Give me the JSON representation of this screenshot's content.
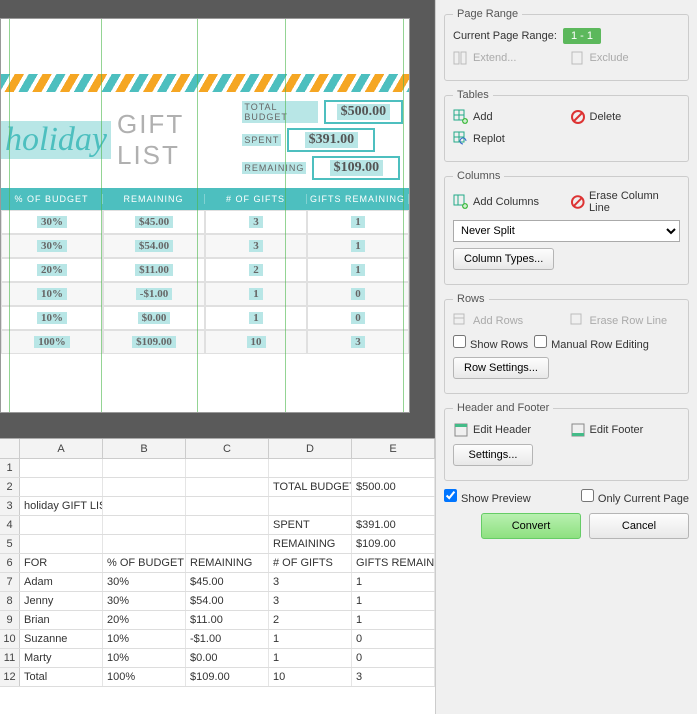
{
  "preview": {
    "title_script": "holiday",
    "title_caps": "GIFT LIST",
    "budget_labels": {
      "total": "TOTAL BUDGET",
      "spent": "SPENT",
      "remaining": "REMAINING"
    },
    "budget_values": {
      "total": "$500.00",
      "spent": "$391.00",
      "remaining": "$109.00"
    },
    "columns": [
      "% OF BUDGET",
      "REMAINING",
      "# OF GIFTS",
      "GIFTS REMAINING"
    ],
    "rows": [
      [
        "30%",
        "$45.00",
        "3",
        "1"
      ],
      [
        "30%",
        "$54.00",
        "3",
        "1"
      ],
      [
        "20%",
        "$11.00",
        "2",
        "1"
      ],
      [
        "10%",
        "-$1.00",
        "1",
        "0"
      ],
      [
        "10%",
        "$0.00",
        "1",
        "0"
      ],
      [
        "100%",
        "$109.00",
        "10",
        "3"
      ]
    ]
  },
  "spreadsheet": {
    "columns": [
      "A",
      "B",
      "C",
      "D",
      "E"
    ],
    "rows": [
      [
        "",
        "",
        "",
        "",
        ""
      ],
      [
        "",
        "",
        "",
        "TOTAL BUDGET",
        "$500.00"
      ],
      [
        "holiday  GIFT LIST",
        "",
        "",
        "",
        ""
      ],
      [
        "",
        "",
        "",
        "SPENT",
        "$391.00"
      ],
      [
        "",
        "",
        "",
        "REMAINING",
        "$109.00"
      ],
      [
        "FOR",
        "% OF BUDGET",
        "REMAINING",
        "# OF GIFTS",
        "GIFTS REMAINING"
      ],
      [
        "Adam",
        "30%",
        "$45.00",
        "3",
        "1"
      ],
      [
        "Jenny",
        "30%",
        "$54.00",
        "3",
        "1"
      ],
      [
        "Brian",
        "20%",
        "$11.00",
        "2",
        "1"
      ],
      [
        "Suzanne",
        "10%",
        "-$1.00",
        "1",
        "0"
      ],
      [
        "Marty",
        "10%",
        "$0.00",
        "1",
        "0"
      ],
      [
        "Total",
        "100%",
        "$109.00",
        "10",
        "3"
      ]
    ]
  },
  "panel": {
    "page_range": {
      "legend": "Page Range",
      "current_label": "Current Page Range:",
      "current_value": "1 - 1",
      "extend": "Extend...",
      "exclude": "Exclude"
    },
    "tables": {
      "legend": "Tables",
      "add": "Add",
      "delete": "Delete",
      "replot": "Replot"
    },
    "columns": {
      "legend": "Columns",
      "add": "Add Columns",
      "erase": "Erase Column Line",
      "split": "Never Split",
      "types": "Column Types..."
    },
    "rows": {
      "legend": "Rows",
      "add": "Add Rows",
      "erase": "Erase Row Line",
      "show": "Show Rows",
      "manual": "Manual Row Editing",
      "settings": "Row Settings..."
    },
    "headerfooter": {
      "legend": "Header and Footer",
      "edit_header": "Edit Header",
      "edit_footer": "Edit Footer",
      "settings": "Settings..."
    },
    "show_preview": "Show Preview",
    "only_current": "Only Current Page",
    "convert": "Convert",
    "cancel": "Cancel"
  }
}
